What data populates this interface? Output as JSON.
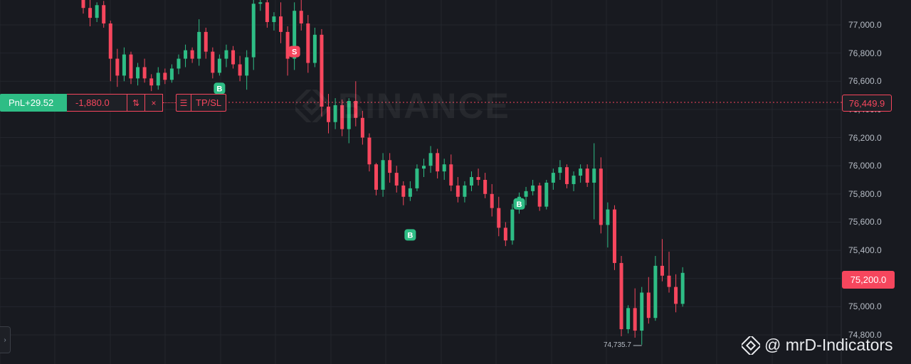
{
  "watermark": {
    "text": "BINANCE",
    "icon": "binance-logo-icon"
  },
  "position_line": {
    "pnl_label": "PnL+29.52",
    "quantity": "-1,880.0",
    "reverse_icon": "⇅",
    "close_icon": "×",
    "menu_icon": "☰",
    "tpsl_label": "TP/SL",
    "entry_price": "76,449.9"
  },
  "last_price": "75,200.0",
  "low_marker": "74,735.7",
  "footer": {
    "handle": "@ mrD-Indicators",
    "icon": "binance-logo-icon"
  },
  "left_handle_icon": "›",
  "colors": {
    "background": "#181a20",
    "up": "#2ebd85",
    "down": "#f6465d",
    "grid": "#23262d",
    "axis_text": "#b7bdc6"
  },
  "chart_data": {
    "type": "candlestick",
    "y_axis": {
      "ticks": [
        "77,000.0",
        "76,800.0",
        "76,600.0",
        "76,400.0",
        "76,200.0",
        "76,000.0",
        "75,800.0",
        "75,600.0",
        "75,400.0",
        "75,200.0",
        "75,000.0",
        "74,800.0"
      ],
      "tick_values": [
        77000,
        76800,
        76600,
        76400,
        76200,
        76000,
        75800,
        75600,
        75400,
        75200,
        75000,
        74800
      ],
      "range": [
        74720,
        77180
      ]
    },
    "grid": true,
    "markers": [
      {
        "label": "B",
        "side": "buy",
        "price": 76600,
        "index": 20
      },
      {
        "label": "S",
        "side": "sell",
        "price": 76780,
        "index": 31
      },
      {
        "label": "B",
        "side": "buy",
        "price": 75560,
        "index": 48
      },
      {
        "label": "B",
        "side": "buy",
        "price": 75780,
        "index": 64
      }
    ],
    "horizontal_lines": [
      {
        "name": "entry",
        "price": 76449.9,
        "style": "dotted"
      }
    ],
    "candles": [
      [
        77180,
        77210,
        77080,
        77120
      ],
      [
        77120,
        77180,
        76990,
        77050
      ],
      [
        77050,
        77160,
        77020,
        77140
      ],
      [
        77140,
        77170,
        76980,
        77010
      ],
      [
        77010,
        77030,
        76600,
        76760
      ],
      [
        76760,
        76830,
        76560,
        76640
      ],
      [
        76640,
        76840,
        76600,
        76790
      ],
      [
        76790,
        76810,
        76580,
        76620
      ],
      [
        76620,
        76730,
        76570,
        76700
      ],
      [
        76700,
        76760,
        76590,
        76620
      ],
      [
        76620,
        76650,
        76530,
        76570
      ],
      [
        76570,
        76700,
        76540,
        76660
      ],
      [
        76660,
        76690,
        76580,
        76610
      ],
      [
        76610,
        76720,
        76590,
        76690
      ],
      [
        76690,
        76790,
        76650,
        76760
      ],
      [
        76760,
        76860,
        76700,
        76820
      ],
      [
        76820,
        76840,
        76730,
        76760
      ],
      [
        76760,
        77040,
        76710,
        76950
      ],
      [
        76950,
        76980,
        76760,
        76810
      ],
      [
        76810,
        76840,
        76620,
        76660
      ],
      [
        76660,
        76790,
        76640,
        76760
      ],
      [
        76760,
        76860,
        76700,
        76820
      ],
      [
        76820,
        76850,
        76690,
        76720
      ],
      [
        76720,
        76780,
        76600,
        76640
      ],
      [
        76640,
        76820,
        76540,
        76770
      ],
      [
        76770,
        77180,
        76680,
        77150
      ],
      [
        77150,
        77210,
        77100,
        77160
      ],
      [
        77160,
        77220,
        76980,
        77020
      ],
      [
        77020,
        77090,
        76960,
        77060
      ],
      [
        77060,
        77160,
        76870,
        76950
      ],
      [
        76950,
        76990,
        76640,
        76760
      ],
      [
        76760,
        77160,
        76680,
        77100
      ],
      [
        77100,
        77210,
        76960,
        77010
      ],
      [
        77010,
        77070,
        76660,
        76730
      ],
      [
        76730,
        76980,
        76700,
        76930
      ],
      [
        76930,
        76970,
        76350,
        76420
      ],
      [
        76420,
        76510,
        76230,
        76310
      ],
      [
        76310,
        76480,
        76260,
        76430
      ],
      [
        76430,
        76470,
        76210,
        76260
      ],
      [
        76260,
        76480,
        76160,
        76460
      ],
      [
        76460,
        76600,
        76280,
        76340
      ],
      [
        76340,
        76390,
        76150,
        76200
      ],
      [
        76200,
        76230,
        75960,
        76010
      ],
      [
        76010,
        76020,
        75790,
        75830
      ],
      [
        75830,
        76090,
        75780,
        76040
      ],
      [
        76040,
        76090,
        75880,
        75950
      ],
      [
        75950,
        76000,
        75810,
        75860
      ],
      [
        75860,
        75890,
        75720,
        75780
      ],
      [
        75780,
        75890,
        75750,
        75840
      ],
      [
        75840,
        76010,
        75820,
        75980
      ],
      [
        75980,
        76050,
        75920,
        76000
      ],
      [
        76000,
        76140,
        75950,
        76090
      ],
      [
        76090,
        76120,
        75910,
        75960
      ],
      [
        75960,
        76050,
        75900,
        76010
      ],
      [
        76010,
        76080,
        75820,
        75860
      ],
      [
        75860,
        75920,
        75740,
        75780
      ],
      [
        75780,
        75890,
        75740,
        75860
      ],
      [
        75860,
        75960,
        75820,
        75920
      ],
      [
        75920,
        75980,
        75860,
        75900
      ],
      [
        75900,
        75950,
        75770,
        75800
      ],
      [
        75800,
        75870,
        75640,
        75700
      ],
      [
        75700,
        75780,
        75500,
        75560
      ],
      [
        75560,
        75600,
        75430,
        75470
      ],
      [
        75470,
        75730,
        75440,
        75690
      ],
      [
        75690,
        75810,
        75660,
        75780
      ],
      [
        75780,
        75850,
        75720,
        75820
      ],
      [
        75820,
        75900,
        75790,
        75860
      ],
      [
        75860,
        75880,
        75680,
        75710
      ],
      [
        75710,
        75900,
        75690,
        75880
      ],
      [
        75880,
        75980,
        75830,
        75950
      ],
      [
        75950,
        76040,
        75900,
        75990
      ],
      [
        75990,
        76010,
        75840,
        75870
      ],
      [
        75870,
        75960,
        75820,
        75930
      ],
      [
        75930,
        76010,
        75880,
        75980
      ],
      [
        75980,
        76010,
        75850,
        75880
      ],
      [
        75880,
        76160,
        75620,
        75980
      ],
      [
        75980,
        76060,
        75520,
        75580
      ],
      [
        75580,
        75740,
        75420,
        75690
      ],
      [
        75690,
        75720,
        75260,
        75310
      ],
      [
        75310,
        75360,
        74790,
        74840
      ],
      [
        74840,
        75010,
        74810,
        74990
      ],
      [
        74990,
        75130,
        74780,
        74830
      ],
      [
        74830,
        75140,
        74730,
        75100
      ],
      [
        75100,
        75210,
        74880,
        74920
      ],
      [
        74920,
        75360,
        74900,
        75290
      ],
      [
        75290,
        75480,
        75180,
        75220
      ],
      [
        75220,
        75390,
        75100,
        75140
      ],
      [
        75140,
        75230,
        74960,
        75020
      ],
      [
        75020,
        75280,
        75000,
        75240
      ]
    ]
  }
}
